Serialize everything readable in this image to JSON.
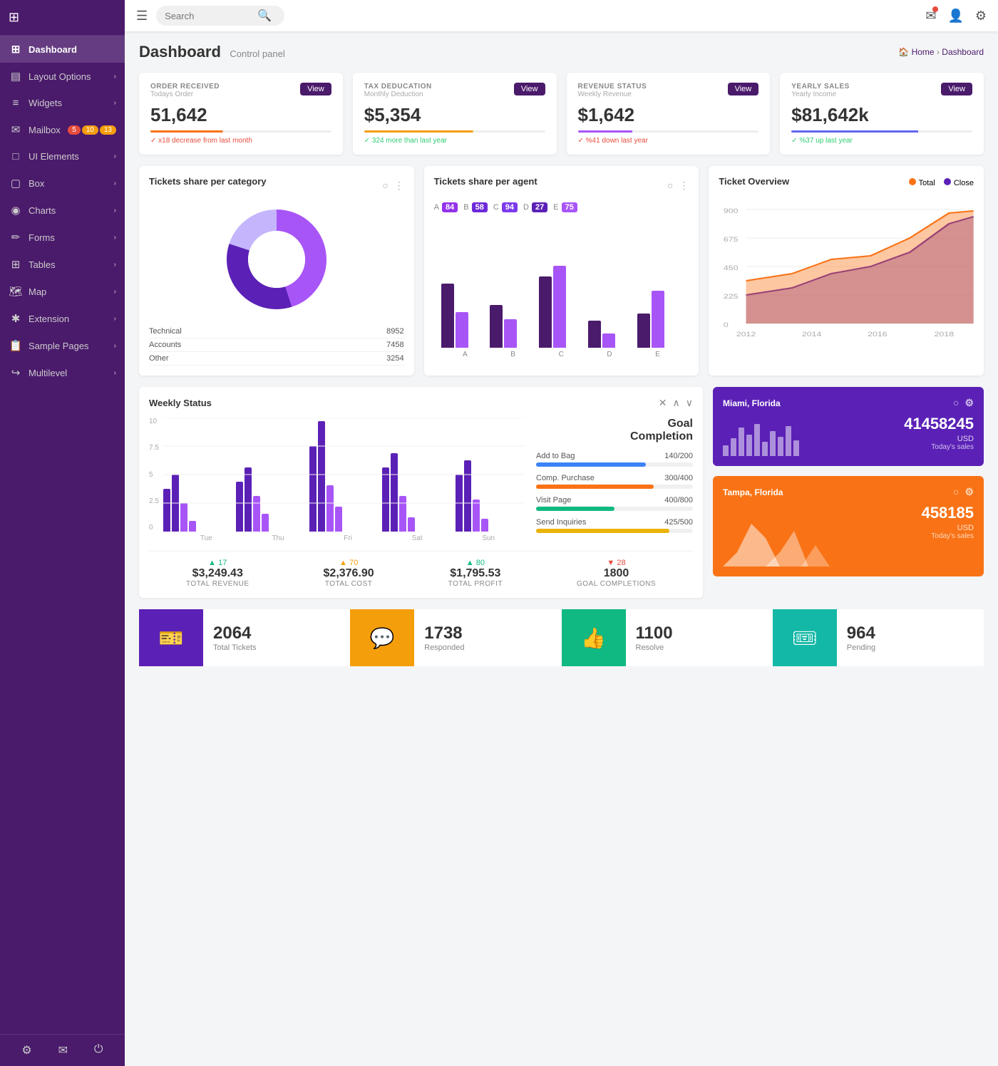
{
  "app": {
    "title": "Dashboard",
    "subtitle": "Control panel",
    "breadcrumb_home": "Home",
    "breadcrumb_current": "Dashboard"
  },
  "topbar": {
    "search_placeholder": "Search",
    "menu_icon": "☰"
  },
  "sidebar": {
    "items": [
      {
        "id": "dashboard",
        "label": "Dashboard",
        "icon": "⊞",
        "active": true
      },
      {
        "id": "layout",
        "label": "Layout Options",
        "icon": "▤",
        "arrow": true
      },
      {
        "id": "widgets",
        "label": "Widgets",
        "icon": "≡",
        "arrow": true
      },
      {
        "id": "mailbox",
        "label": "Mailbox",
        "icon": "✉",
        "badges": [
          "5",
          "10",
          "13"
        ]
      },
      {
        "id": "ui",
        "label": "UI Elements",
        "icon": "□",
        "arrow": true
      },
      {
        "id": "box",
        "label": "Box",
        "icon": "▢",
        "arrow": true
      },
      {
        "id": "charts",
        "label": "Charts",
        "icon": "◉",
        "arrow": true
      },
      {
        "id": "forms",
        "label": "Forms",
        "icon": "✏",
        "arrow": true
      },
      {
        "id": "tables",
        "label": "Tables",
        "icon": "⊞",
        "arrow": true
      },
      {
        "id": "map",
        "label": "Map",
        "icon": "🗺",
        "arrow": true
      },
      {
        "id": "extension",
        "label": "Extension",
        "icon": "✱",
        "arrow": true
      },
      {
        "id": "sample",
        "label": "Sample Pages",
        "icon": "📋",
        "arrow": true
      },
      {
        "id": "multilevel",
        "label": "Multilevel",
        "icon": "↪",
        "arrow": true
      }
    ],
    "footer": [
      "⚙",
      "✉",
      "⏻"
    ]
  },
  "stat_cards": [
    {
      "label": "ORDER RECEIVED",
      "sublabel": "Todays Order",
      "value": "51,642",
      "btn": "View",
      "bar_color": "#f97316",
      "bar_pct": 40,
      "change": "✓ x18 decrease from last month",
      "change_type": "down"
    },
    {
      "label": "TAX DEDUCATION",
      "sublabel": "Monthly Deduction",
      "value": "$5,354",
      "btn": "View",
      "bar_color": "#f59e0b",
      "bar_pct": 60,
      "change": "✓ 324 more than last year",
      "change_type": "up"
    },
    {
      "label": "REVENUE STATUS",
      "sublabel": "Weekly Revenue",
      "value": "$1,642",
      "btn": "View",
      "bar_color": "#a855f7",
      "bar_pct": 30,
      "change": "✓ %41 down last year",
      "change_type": "down"
    },
    {
      "label": "YEARLY SALES",
      "sublabel": "Yearly Income",
      "value": "$81,642k",
      "btn": "View",
      "bar_color": "#6366f1",
      "bar_pct": 70,
      "change": "✓ %37 up last year",
      "change_type": "up"
    }
  ],
  "donut_chart": {
    "title": "Tickets share per category",
    "segments": [
      {
        "label": "Technical",
        "value": 8952,
        "color": "#a855f7",
        "pct": 45
      },
      {
        "label": "Accounts",
        "value": 7458,
        "color": "#5b21b6",
        "pct": 35
      },
      {
        "label": "Other",
        "value": 3254,
        "color": "#c4b5fd",
        "pct": 20
      }
    ]
  },
  "bar_chart_agents": {
    "title": "Tickets share per agent",
    "agents": [
      {
        "letter": "A",
        "count": 84,
        "color1": "#4a1a6b",
        "color2": "#a855f7",
        "h1": 90,
        "h2": 50
      },
      {
        "letter": "B",
        "count": 58,
        "color1": "#4a1a6b",
        "color2": "#a855f7",
        "h1": 60,
        "h2": 40
      },
      {
        "letter": "C",
        "count": 94,
        "color1": "#4a1a6b",
        "color2": "#a855f7",
        "h1": 100,
        "h2": 110
      },
      {
        "letter": "D",
        "count": 27,
        "color1": "#4a1a6b",
        "color2": "#a855f7",
        "h1": 40,
        "h2": 20
      },
      {
        "letter": "E",
        "count": 75,
        "color1": "#4a1a6b",
        "color2": "#a855f7",
        "h1": 50,
        "h2": 80
      }
    ],
    "badge_colors": [
      "#9333ea",
      "#6d28d9",
      "#7c3aed",
      "#5b21b6",
      "#a855f7"
    ]
  },
  "ticket_overview": {
    "title": "Ticket Overview",
    "legend": [
      {
        "label": "Total",
        "color": "#f97316"
      },
      {
        "label": "Close",
        "color": "#5b21b6"
      }
    ],
    "y_labels": [
      "900",
      "675",
      "450",
      "225",
      "0"
    ],
    "x_labels": [
      "2012",
      "2014",
      "2016",
      "2018"
    ]
  },
  "weekly_status": {
    "title": "Weekly Status",
    "days": [
      "Tue",
      "Thu",
      "Fri",
      "Sat",
      "Sun"
    ],
    "y_labels": [
      "10",
      "7.5",
      "5",
      "2.5",
      "0"
    ],
    "stats": [
      {
        "value": "$3,249.43",
        "label": "TOTAL REVENUE",
        "change": "+17",
        "change_type": "up"
      },
      {
        "value": "$2,376.90",
        "label": "TOTAL COST",
        "change": "+70",
        "change_type": "down"
      },
      {
        "value": "$1,795.53",
        "label": "TOTAL PROFIT",
        "change": "+80",
        "change_type": "up"
      },
      {
        "value": "1800",
        "label": "GOAL COMPLETIONS",
        "change": "+28",
        "change_type": "down"
      }
    ]
  },
  "goal_completion": {
    "title": "Goal\nCompletion",
    "items": [
      {
        "label": "Add to Bag",
        "current": 140,
        "total": 200,
        "color": "#3b82f6",
        "pct": 70
      },
      {
        "label": "Comp. Purchase",
        "current": 300,
        "total": 400,
        "color": "#f97316",
        "pct": 75
      },
      {
        "label": "Visit Page",
        "current": 400,
        "total": 800,
        "color": "#10b981",
        "pct": 50
      },
      {
        "label": "Send Inquiries",
        "current": 425,
        "total": 500,
        "color": "#eab308",
        "pct": 85
      }
    ]
  },
  "miami_card": {
    "title": "Miami, Florida",
    "value": "41458245",
    "currency": "USD",
    "sublabel": "Today's sales",
    "bars": [
      30,
      50,
      80,
      60,
      90,
      40,
      70,
      55,
      85,
      45
    ]
  },
  "tampa_card": {
    "title": "Tampa, Florida",
    "value": "458185",
    "currency": "USD",
    "sublabel": "Today's sales",
    "bars": [
      40,
      90,
      70,
      110,
      60,
      80,
      50,
      30
    ]
  },
  "bottom_stats": [
    {
      "icon": "🎫",
      "value": "2064",
      "label": "Total Tickets",
      "color": "purple"
    },
    {
      "icon": "💬",
      "value": "1738",
      "label": "Responded",
      "color": "yellow"
    },
    {
      "icon": "👍",
      "value": "1100",
      "label": "Resolve",
      "color": "green"
    },
    {
      "icon": "🎟",
      "value": "964",
      "label": "Pending",
      "color": "teal"
    }
  ]
}
